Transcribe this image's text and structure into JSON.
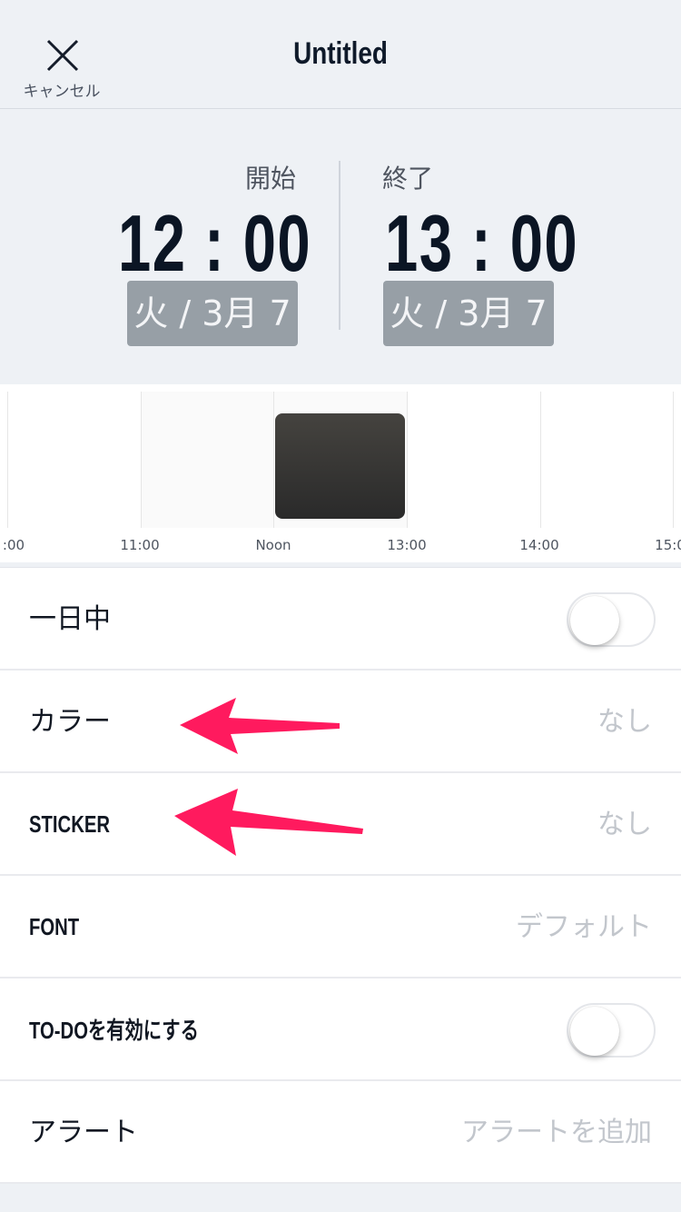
{
  "header": {
    "cancel_label": "キャンセル",
    "title": "Untitled"
  },
  "start": {
    "label": "開始",
    "time": "12 : 00",
    "date": "火 / 3月 7"
  },
  "end": {
    "label": "終了",
    "time": "13 : 00",
    "date": "火 / 3月 7"
  },
  "timeline": {
    "ticks": [
      ":00",
      "11:00",
      "Noon",
      "13:00",
      "14:00",
      "15:0"
    ]
  },
  "rows": {
    "all_day": {
      "label": "一日中",
      "on": false
    },
    "color": {
      "label": "カラー",
      "value": "なし"
    },
    "sticker": {
      "label": "STICKER",
      "value": "なし"
    },
    "font": {
      "label": "FONT",
      "value": "デフォルト"
    },
    "todo": {
      "label": "TO-DOを有効にする",
      "on": false
    },
    "alert": {
      "label": "アラート",
      "value": "アラートを追加"
    }
  },
  "colors": {
    "arrow": "#ff1a5e",
    "date_chip": "#979fa6",
    "event_block": "#3a3936"
  },
  "icons": {
    "cancel": "close-icon",
    "annotation": "arrow-left-icon"
  }
}
